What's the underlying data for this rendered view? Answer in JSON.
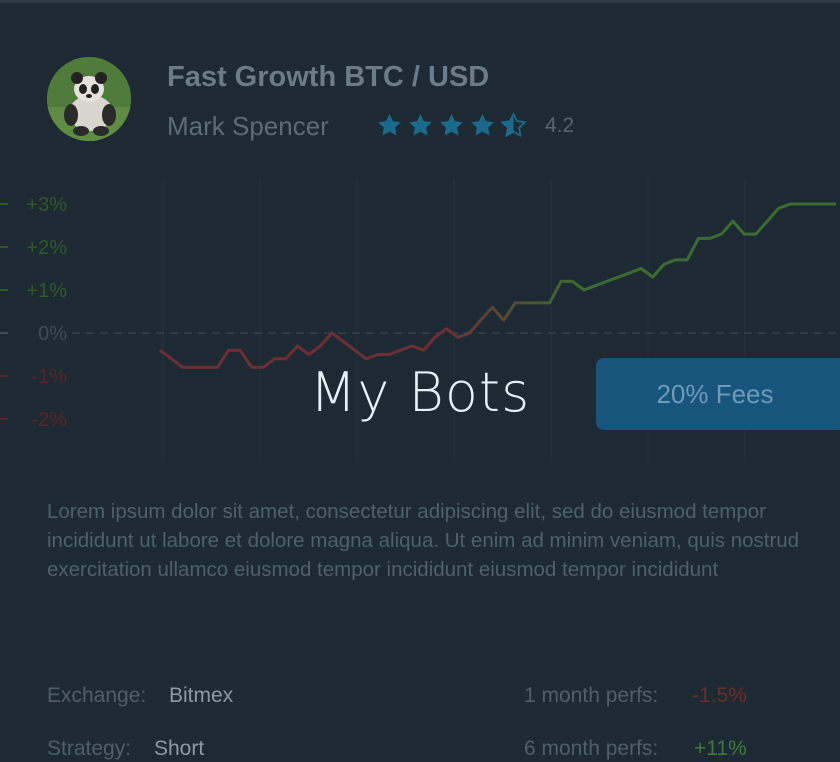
{
  "bot": {
    "title": "Fast Growth BTC / USD",
    "author": "Mark Spencer",
    "rating_value": "4.2",
    "rating_stars": 4.2
  },
  "icons": {
    "avatar": "panda-avatar",
    "star": "star-icon"
  },
  "chart_data": {
    "type": "line",
    "y_tick_labels": [
      "+3%",
      "+2%",
      "+1%",
      "0%",
      "-1%",
      "-2%"
    ],
    "ylim": [
      -2.5,
      3.3
    ],
    "grid": true,
    "x": [
      0,
      1,
      2,
      3,
      4,
      5,
      6,
      7,
      8,
      9,
      10,
      11,
      12,
      13,
      14,
      15,
      16,
      17,
      18,
      19,
      20,
      21,
      22,
      23,
      24,
      25,
      26,
      27,
      28,
      29,
      30,
      31,
      32,
      33,
      34,
      35,
      36,
      37,
      38,
      39,
      40,
      41,
      42,
      43,
      44,
      45,
      46,
      47,
      48,
      49,
      50,
      51,
      52,
      53,
      54,
      55,
      56,
      57,
      58,
      59
    ],
    "values": [
      -0.4,
      -0.6,
      -0.8,
      -0.8,
      -0.8,
      -0.8,
      -0.4,
      -0.4,
      -0.8,
      -0.8,
      -0.6,
      -0.6,
      -0.3,
      -0.5,
      -0.3,
      0.0,
      -0.2,
      -0.4,
      -0.6,
      -0.5,
      -0.5,
      -0.4,
      -0.3,
      -0.4,
      -0.1,
      0.1,
      -0.1,
      0.0,
      0.3,
      0.6,
      0.3,
      0.7,
      0.7,
      0.7,
      0.7,
      1.2,
      1.2,
      1.0,
      1.1,
      1.2,
      1.3,
      1.4,
      1.5,
      1.3,
      1.6,
      1.7,
      1.7,
      2.2,
      2.2,
      2.3,
      2.6,
      2.3,
      2.3,
      2.6,
      2.9,
      3.0,
      3.0,
      3.0,
      3.0,
      3.0
    ],
    "colors": {
      "negative": "#6e2f33",
      "positive": "#3a6b31"
    }
  },
  "fees_button": {
    "label": "20% Fees"
  },
  "overlay": {
    "title": "My Bots"
  },
  "description": "Lorem ipsum dolor sit amet, consectetur adipiscing elit, sed do eiusmod tempor incididunt ut labore et dolore magna aliqua. Ut enim ad minim veniam, quis nostrud exercitation ullamco eiusmod tempor incididunt eiusmod tempor incididunt",
  "details": {
    "exchange_label": "Exchange:",
    "exchange_value": "Bitmex",
    "strategy_label": "Strategy:",
    "strategy_value": "Short",
    "perf_1m_label": "1 month perfs:",
    "perf_1m_value": "-1.5%",
    "perf_6m_label": "6 month perfs:",
    "perf_6m_value": "+11%"
  }
}
